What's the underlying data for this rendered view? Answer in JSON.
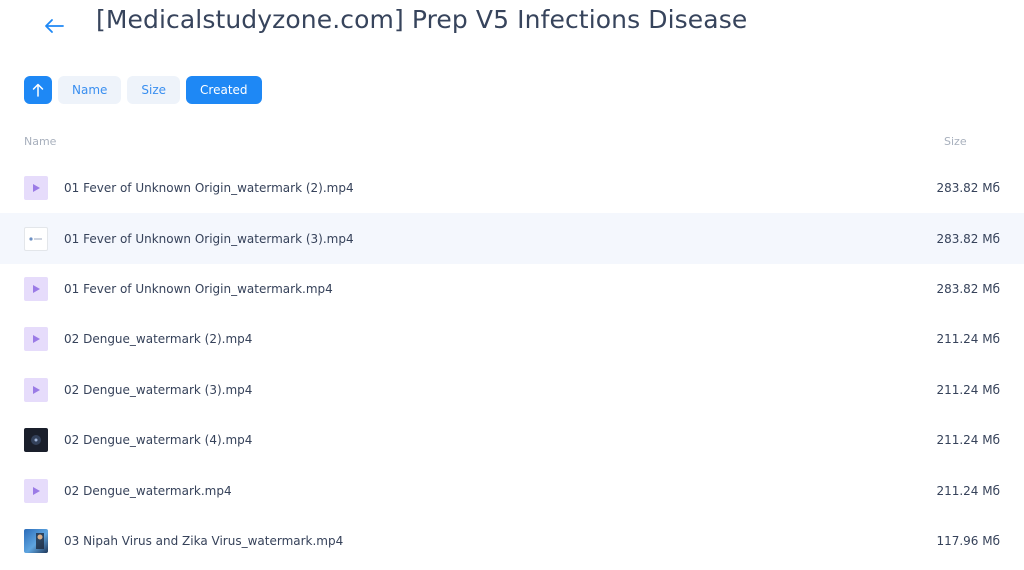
{
  "header": {
    "title": "[Medicalstudyzone.com] Prep V5 Infections Disease"
  },
  "sortbar": {
    "buttons": [
      {
        "label": "Name",
        "active": false
      },
      {
        "label": "Size",
        "active": false
      },
      {
        "label": "Created",
        "active": true
      }
    ]
  },
  "columns": {
    "name": "Name",
    "size": "Size"
  },
  "colors": {
    "accent": "#1e88f5",
    "video_thumb": "#e6dcfb",
    "video_glyph": "#9b7be6",
    "row_highlight": "#f4f7fd"
  },
  "files": [
    {
      "name": "01 Fever of Unknown Origin_watermark (2).mp4",
      "size": "283.82 Мб",
      "thumb": "video-icon"
    },
    {
      "name": "01 Fever of Unknown Origin_watermark (3).mp4",
      "size": "283.82 Мб",
      "thumb": "preview-white"
    },
    {
      "name": "01 Fever of Unknown Origin_watermark.mp4",
      "size": "283.82 Мб",
      "thumb": "video-icon"
    },
    {
      "name": "02 Dengue_watermark (2).mp4",
      "size": "211.24 Мб",
      "thumb": "video-icon"
    },
    {
      "name": "02 Dengue_watermark (3).mp4",
      "size": "211.24 Мб",
      "thumb": "video-icon"
    },
    {
      "name": "02 Dengue_watermark (4).mp4",
      "size": "211.24 Мб",
      "thumb": "preview-dark"
    },
    {
      "name": "02 Dengue_watermark.mp4",
      "size": "211.24 Мб",
      "thumb": "video-icon"
    },
    {
      "name": "03 Nipah Virus and Zika Virus_watermark.mp4",
      "size": "117.96 Мб",
      "thumb": "preview-photo"
    }
  ]
}
